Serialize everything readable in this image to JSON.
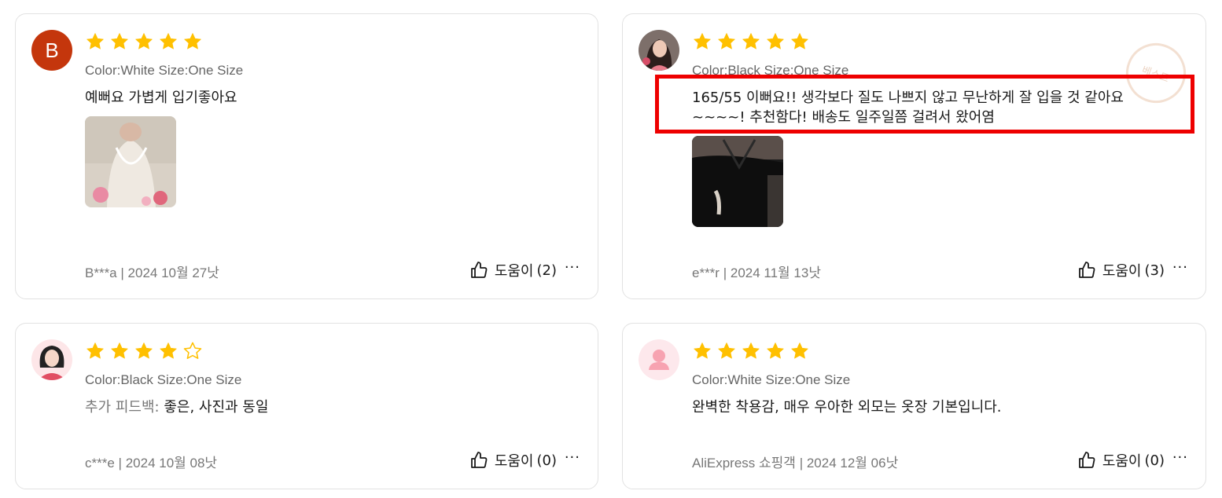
{
  "colors": {
    "star": "#ffc000",
    "star_outline": "#ffc000",
    "border": "#e2e2e2",
    "highlight": "#ee0000",
    "avatar_letter_bg": "#c4360c"
  },
  "reviews": [
    {
      "avatar_type": "letter",
      "avatar_letter": "B",
      "rating": 5,
      "sku": "Color:White Size:One Size",
      "prefix": "",
      "text_lines": [
        "예뻐요 가볍게 입기좋아요"
      ],
      "has_photo": true,
      "reviewer": "B***a",
      "date": "2024 10월 27낫",
      "helpful_label": "도움이",
      "helpful_count": "(2)",
      "more_icon": "ellipsis-icon"
    },
    {
      "avatar_type": "photo",
      "rating": 5,
      "sku": "Color:Black Size:One Size",
      "prefix": "",
      "text_lines": [
        "165/55 이뻐요!! 생각보다 질도 나쁘지 않고 무난하게 잘 입을 것 같아요",
        "~~~~! 추천함다! 배송도 일주일쯤 걸려서 왔어염"
      ],
      "has_photo": true,
      "reviewer": "e***r",
      "date": "2024 11월 13낫",
      "helpful_label": "도움이",
      "helpful_count": "(3)",
      "more_icon": "ellipsis-icon"
    },
    {
      "avatar_type": "illustration-woman",
      "rating": 4,
      "sku": "Color:Black Size:One Size",
      "prefix": "추가 피드백:",
      "text_lines": [
        "좋은, 사진과 동일"
      ],
      "has_photo": false,
      "reviewer": "c***e",
      "date": "2024 10월 08낫",
      "helpful_label": "도움이",
      "helpful_count": "(0)",
      "more_icon": "ellipsis-icon"
    },
    {
      "avatar_type": "placeholder-person",
      "rating": 5,
      "sku": "Color:White Size:One Size",
      "prefix": "",
      "text_lines": [
        "완벽한 착용감, 매우 우아한 외모는 옷장 기본입니다."
      ],
      "has_photo": false,
      "reviewer": "AliExpress 쇼핑객",
      "date": "2024 12월 06낫",
      "helpful_label": "도움이",
      "helpful_count": "(0)",
      "more_icon": "ellipsis-icon"
    }
  ],
  "separator": "|",
  "more_glyph": "···",
  "stamp_text": "베스트"
}
